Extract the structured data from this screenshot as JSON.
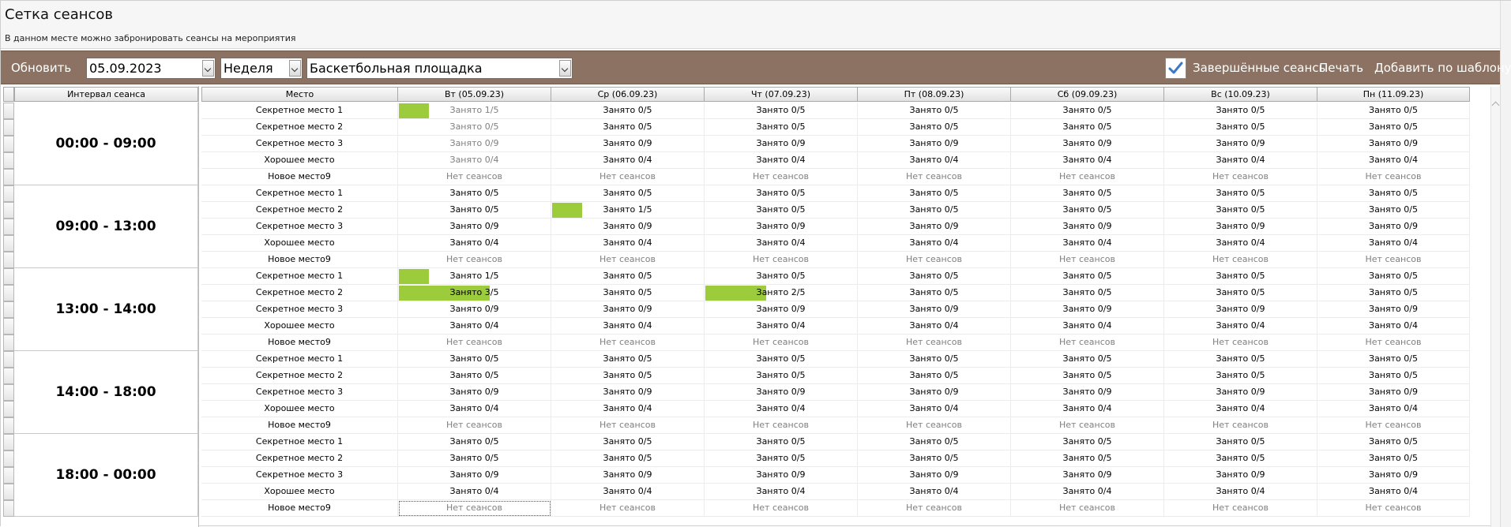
{
  "header": {
    "title": "Сетка сеансов",
    "subtitle": "В данном месте можно забронировать сеансы на мероприятия"
  },
  "toolbar": {
    "refresh_label": "Обновить",
    "date_value": "05.09.2023",
    "period_value": "Неделя",
    "venue_value": "Баскетбольная площадка",
    "completed_checked": true,
    "completed_label": "Завершённые сеансы",
    "print_label": "Печать",
    "template_label": "Добавить по шаблону"
  },
  "intervals_header": "Интервал сеанса",
  "place_header": "Место",
  "days": [
    "Вт (05.09.23)",
    "Ср (06.09.23)",
    "Чт (07.09.23)",
    "Пт (08.09.23)",
    "Сб (09.09.23)",
    "Вс (10.09.23)",
    "Пн (11.09.23)"
  ],
  "colors": {
    "toolbar": "#8b7262",
    "booked_bar": "#9ccc3c"
  },
  "intervals": [
    {
      "label": "00:00 - 09:00",
      "rows": [
        {
          "place": "Секретное место 1",
          "cells": [
            {
              "text": "Занято 1/5",
              "dim": true,
              "fill": 0.2
            },
            {
              "text": "Занято 0/5"
            },
            {
              "text": "Занято 0/5"
            },
            {
              "text": "Занято 0/5"
            },
            {
              "text": "Занято 0/5"
            },
            {
              "text": "Занято 0/5"
            },
            {
              "text": "Занято 0/5"
            }
          ]
        },
        {
          "place": "Секретное место 2",
          "cells": [
            {
              "text": "Занято 0/5",
              "dim": true
            },
            {
              "text": "Занято 0/5"
            },
            {
              "text": "Занято 0/5"
            },
            {
              "text": "Занято 0/5"
            },
            {
              "text": "Занято 0/5"
            },
            {
              "text": "Занято 0/5"
            },
            {
              "text": "Занято 0/5"
            }
          ]
        },
        {
          "place": "Секретное место 3",
          "cells": [
            {
              "text": "Занято 0/9",
              "dim": true
            },
            {
              "text": "Занято 0/9"
            },
            {
              "text": "Занято 0/9"
            },
            {
              "text": "Занято 0/9"
            },
            {
              "text": "Занято 0/9"
            },
            {
              "text": "Занято 0/9"
            },
            {
              "text": "Занято 0/9"
            }
          ]
        },
        {
          "place": "Хорошее место",
          "cells": [
            {
              "text": "Занято 0/4",
              "dim": true
            },
            {
              "text": "Занято 0/4"
            },
            {
              "text": "Занято 0/4"
            },
            {
              "text": "Занято 0/4"
            },
            {
              "text": "Занято 0/4"
            },
            {
              "text": "Занято 0/4"
            },
            {
              "text": "Занято 0/4"
            }
          ]
        },
        {
          "place": "Новое место9",
          "cells": [
            {
              "text": "Нет сеансов",
              "dim": true
            },
            {
              "text": "Нет сеансов",
              "dim": true
            },
            {
              "text": "Нет сеансов",
              "dim": true
            },
            {
              "text": "Нет сеансов",
              "dim": true
            },
            {
              "text": "Нет сеансов",
              "dim": true
            },
            {
              "text": "Нет сеансов",
              "dim": true
            },
            {
              "text": "Нет сеансов",
              "dim": true
            }
          ]
        }
      ]
    },
    {
      "label": "09:00 - 13:00",
      "rows": [
        {
          "place": "Секретное место 1",
          "cells": [
            {
              "text": "Занято 0/5"
            },
            {
              "text": "Занято 0/5"
            },
            {
              "text": "Занято 0/5"
            },
            {
              "text": "Занято 0/5"
            },
            {
              "text": "Занято 0/5"
            },
            {
              "text": "Занято 0/5"
            },
            {
              "text": "Занято 0/5"
            }
          ]
        },
        {
          "place": "Секретное место 2",
          "cells": [
            {
              "text": "Занято 0/5"
            },
            {
              "text": "Занято 1/5",
              "fill": 0.2
            },
            {
              "text": "Занято 0/5"
            },
            {
              "text": "Занято 0/5"
            },
            {
              "text": "Занято 0/5"
            },
            {
              "text": "Занято 0/5"
            },
            {
              "text": "Занято 0/5"
            }
          ]
        },
        {
          "place": "Секретное место 3",
          "cells": [
            {
              "text": "Занято 0/9"
            },
            {
              "text": "Занято 0/9"
            },
            {
              "text": "Занято 0/9"
            },
            {
              "text": "Занято 0/9"
            },
            {
              "text": "Занято 0/9"
            },
            {
              "text": "Занято 0/9"
            },
            {
              "text": "Занято 0/9"
            }
          ]
        },
        {
          "place": "Хорошее место",
          "cells": [
            {
              "text": "Занято 0/4"
            },
            {
              "text": "Занято 0/4"
            },
            {
              "text": "Занято 0/4"
            },
            {
              "text": "Занято 0/4"
            },
            {
              "text": "Занято 0/4"
            },
            {
              "text": "Занято 0/4"
            },
            {
              "text": "Занято 0/4"
            }
          ]
        },
        {
          "place": "Новое место9",
          "cells": [
            {
              "text": "Нет сеансов",
              "dim": true
            },
            {
              "text": "Нет сеансов",
              "dim": true
            },
            {
              "text": "Нет сеансов",
              "dim": true
            },
            {
              "text": "Нет сеансов",
              "dim": true
            },
            {
              "text": "Нет сеансов",
              "dim": true
            },
            {
              "text": "Нет сеансов",
              "dim": true
            },
            {
              "text": "Нет сеансов",
              "dim": true
            }
          ]
        }
      ]
    },
    {
      "label": "13:00 - 14:00",
      "rows": [
        {
          "place": "Секретное место 1",
          "cells": [
            {
              "text": "Занято 1/5",
              "fill": 0.2
            },
            {
              "text": "Занято 0/5"
            },
            {
              "text": "Занято 0/5"
            },
            {
              "text": "Занято 0/5"
            },
            {
              "text": "Занято 0/5"
            },
            {
              "text": "Занято 0/5"
            },
            {
              "text": "Занято 0/5"
            }
          ]
        },
        {
          "place": "Секретное место 2",
          "cells": [
            {
              "text": "Занято 3/5",
              "fill": 0.6
            },
            {
              "text": "Занято 0/5"
            },
            {
              "text": "Занято 2/5",
              "fill": 0.4
            },
            {
              "text": "Занято 0/5"
            },
            {
              "text": "Занято 0/5"
            },
            {
              "text": "Занято 0/5"
            },
            {
              "text": "Занято 0/5"
            }
          ]
        },
        {
          "place": "Секретное место 3",
          "cells": [
            {
              "text": "Занято 0/9"
            },
            {
              "text": "Занято 0/9"
            },
            {
              "text": "Занято 0/9"
            },
            {
              "text": "Занято 0/9"
            },
            {
              "text": "Занято 0/9"
            },
            {
              "text": "Занято 0/9"
            },
            {
              "text": "Занято 0/9"
            }
          ]
        },
        {
          "place": "Хорошее место",
          "cells": [
            {
              "text": "Занято 0/4"
            },
            {
              "text": "Занято 0/4"
            },
            {
              "text": "Занято 0/4"
            },
            {
              "text": "Занято 0/4"
            },
            {
              "text": "Занято 0/4"
            },
            {
              "text": "Занято 0/4"
            },
            {
              "text": "Занято 0/4"
            }
          ]
        },
        {
          "place": "Новое место9",
          "cells": [
            {
              "text": "Нет сеансов",
              "dim": true
            },
            {
              "text": "Нет сеансов",
              "dim": true
            },
            {
              "text": "Нет сеансов",
              "dim": true
            },
            {
              "text": "Нет сеансов",
              "dim": true
            },
            {
              "text": "Нет сеансов",
              "dim": true
            },
            {
              "text": "Нет сеансов",
              "dim": true
            },
            {
              "text": "Нет сеансов",
              "dim": true
            }
          ]
        }
      ]
    },
    {
      "label": "14:00 - 18:00",
      "rows": [
        {
          "place": "Секретное место 1",
          "cells": [
            {
              "text": "Занято 0/5"
            },
            {
              "text": "Занято 0/5"
            },
            {
              "text": "Занято 0/5"
            },
            {
              "text": "Занято 0/5"
            },
            {
              "text": "Занято 0/5"
            },
            {
              "text": "Занято 0/5"
            },
            {
              "text": "Занято 0/5"
            }
          ]
        },
        {
          "place": "Секретное место 2",
          "cells": [
            {
              "text": "Занято 0/5"
            },
            {
              "text": "Занято 0/5"
            },
            {
              "text": "Занято 0/5"
            },
            {
              "text": "Занято 0/5"
            },
            {
              "text": "Занято 0/5"
            },
            {
              "text": "Занято 0/5"
            },
            {
              "text": "Занято 0/5"
            }
          ]
        },
        {
          "place": "Секретное место 3",
          "cells": [
            {
              "text": "Занято 0/9"
            },
            {
              "text": "Занято 0/9"
            },
            {
              "text": "Занято 0/9"
            },
            {
              "text": "Занято 0/9"
            },
            {
              "text": "Занято 0/9"
            },
            {
              "text": "Занято 0/9"
            },
            {
              "text": "Занято 0/9"
            }
          ]
        },
        {
          "place": "Хорошее место",
          "cells": [
            {
              "text": "Занято 0/4"
            },
            {
              "text": "Занято 0/4"
            },
            {
              "text": "Занято 0/4"
            },
            {
              "text": "Занято 0/4"
            },
            {
              "text": "Занято 0/4"
            },
            {
              "text": "Занято 0/4"
            },
            {
              "text": "Занято 0/4"
            }
          ]
        },
        {
          "place": "Новое место9",
          "cells": [
            {
              "text": "Нет сеансов",
              "dim": true
            },
            {
              "text": "Нет сеансов",
              "dim": true
            },
            {
              "text": "Нет сеансов",
              "dim": true
            },
            {
              "text": "Нет сеансов",
              "dim": true
            },
            {
              "text": "Нет сеансов",
              "dim": true
            },
            {
              "text": "Нет сеансов",
              "dim": true
            },
            {
              "text": "Нет сеансов",
              "dim": true
            }
          ]
        }
      ]
    },
    {
      "label": "18:00 - 00:00",
      "rows": [
        {
          "place": "Секретное место 1",
          "cells": [
            {
              "text": "Занято 0/5"
            },
            {
              "text": "Занято 0/5"
            },
            {
              "text": "Занято 0/5"
            },
            {
              "text": "Занято 0/5"
            },
            {
              "text": "Занято 0/5"
            },
            {
              "text": "Занято 0/5"
            },
            {
              "text": "Занято 0/5"
            }
          ]
        },
        {
          "place": "Секретное место 2",
          "cells": [
            {
              "text": "Занято 0/5"
            },
            {
              "text": "Занято 0/5"
            },
            {
              "text": "Занято 0/5"
            },
            {
              "text": "Занято 0/5"
            },
            {
              "text": "Занято 0/5"
            },
            {
              "text": "Занято 0/5"
            },
            {
              "text": "Занято 0/5"
            }
          ]
        },
        {
          "place": "Секретное место 3",
          "cells": [
            {
              "text": "Занято 0/9"
            },
            {
              "text": "Занято 0/9"
            },
            {
              "text": "Занято 0/9"
            },
            {
              "text": "Занято 0/9"
            },
            {
              "text": "Занято 0/9"
            },
            {
              "text": "Занято 0/9"
            },
            {
              "text": "Занято 0/9"
            }
          ]
        },
        {
          "place": "Хорошее место",
          "cells": [
            {
              "text": "Занято 0/4"
            },
            {
              "text": "Занято 0/4"
            },
            {
              "text": "Занято 0/4"
            },
            {
              "text": "Занято 0/4"
            },
            {
              "text": "Занято 0/4"
            },
            {
              "text": "Занято 0/4"
            },
            {
              "text": "Занято 0/4"
            }
          ]
        },
        {
          "place": "Новое место9",
          "cells": [
            {
              "text": "Нет сеансов",
              "dim": true,
              "focused": true
            },
            {
              "text": "Нет сеансов",
              "dim": true
            },
            {
              "text": "Нет сеансов",
              "dim": true
            },
            {
              "text": "Нет сеансов",
              "dim": true
            },
            {
              "text": "Нет сеансов",
              "dim": true
            },
            {
              "text": "Нет сеансов",
              "dim": true
            },
            {
              "text": "Нет сеансов",
              "dim": true
            }
          ]
        }
      ]
    }
  ]
}
